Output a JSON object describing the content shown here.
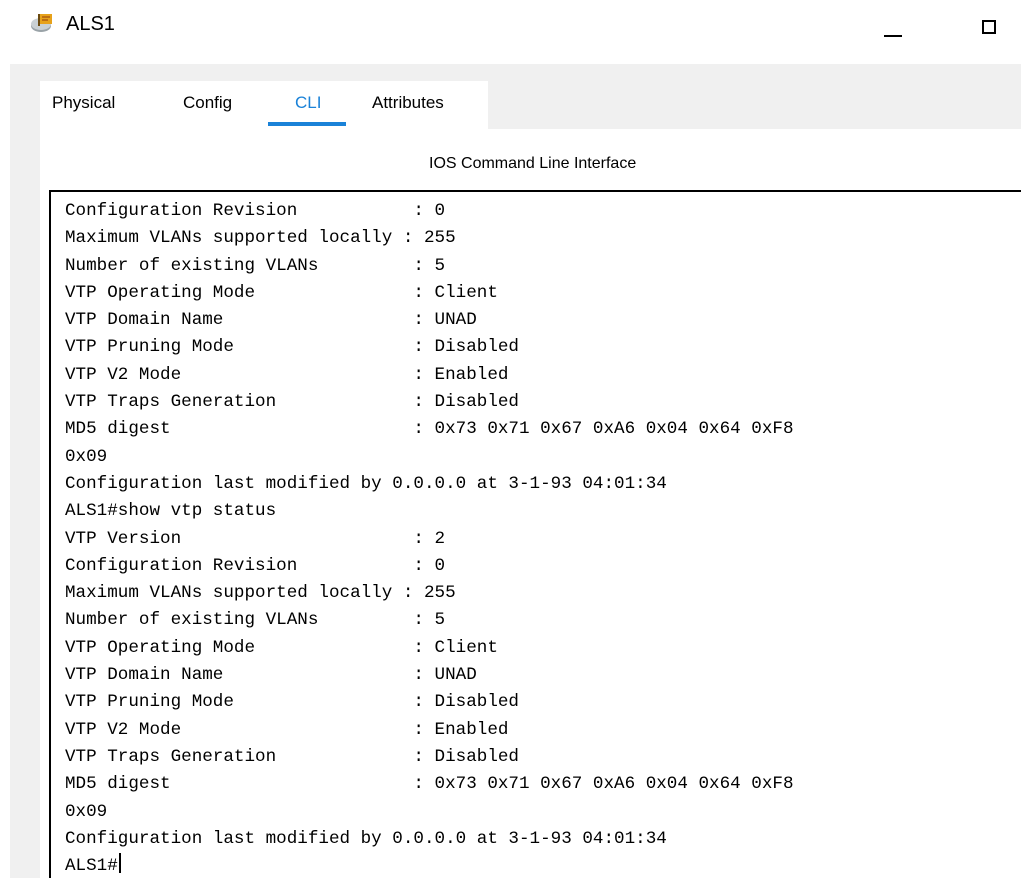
{
  "window": {
    "title": "ALS1",
    "icon": "router-device-icon",
    "minimize_icon": "minimize-icon",
    "maximize_icon": "maximize-icon"
  },
  "tabs": [
    {
      "label": "Physical",
      "active": false
    },
    {
      "label": "Config",
      "active": false
    },
    {
      "label": "CLI",
      "active": true
    },
    {
      "label": "Attributes",
      "active": false
    }
  ],
  "colors": {
    "accent": "#1a82d8",
    "window_bg": "#f0f0f0",
    "panel_bg": "#ffffff",
    "text": "#000000"
  },
  "cli": {
    "caption": "IOS Command Line Interface",
    "lines": [
      "Configuration Revision           : 0",
      "Maximum VLANs supported locally : 255",
      "Number of existing VLANs         : 5",
      "VTP Operating Mode               : Client",
      "VTP Domain Name                  : UNAD",
      "VTP Pruning Mode                 : Disabled",
      "VTP V2 Mode                      : Enabled",
      "VTP Traps Generation             : Disabled",
      "MD5 digest                       : 0x73 0x71 0x67 0xA6 0x04 0x64 0xF8",
      "0x09",
      "Configuration last modified by 0.0.0.0 at 3-1-93 04:01:34",
      "ALS1#show vtp status",
      "VTP Version                      : 2",
      "Configuration Revision           : 0",
      "Maximum VLANs supported locally : 255",
      "Number of existing VLANs         : 5",
      "VTP Operating Mode               : Client",
      "VTP Domain Name                  : UNAD",
      "VTP Pruning Mode                 : Disabled",
      "VTP V2 Mode                      : Enabled",
      "VTP Traps Generation             : Disabled",
      "MD5 digest                       : 0x73 0x71 0x67 0xA6 0x04 0x64 0xF8",
      "0x09",
      "Configuration last modified by 0.0.0.0 at 3-1-93 04:01:34",
      "ALS1#"
    ]
  }
}
